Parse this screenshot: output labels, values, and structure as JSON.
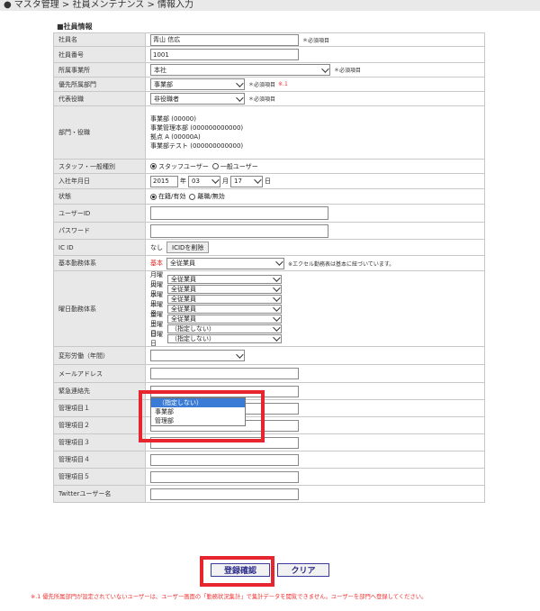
{
  "header": {
    "breadcrumb": "マスタ管理 > 社員メンテナンス > 情報入力",
    "hidden_title": "社員メンテナンス"
  },
  "section_title": "■社員情報",
  "fields": {
    "name": {
      "label": "社員名",
      "value": "青山 信広",
      "req": "＊必須項目"
    },
    "number": {
      "label": "社員番号",
      "value": "1001"
    },
    "office": {
      "label": "所属事業所",
      "value": "本社",
      "req": "＊必須項目"
    },
    "dept": {
      "label": "優先所属部門",
      "value": "事業部",
      "req": "＊必須項目",
      "note": "※.1"
    },
    "role": {
      "label": "代表役職",
      "value": "非役職者",
      "req": "＊必須項目"
    },
    "dept_role": {
      "label": "部門・役職",
      "items": [
        "事業部 (00000)",
        "事業管理本部 (000000000000)",
        "拠点 A (00000A)",
        "事業部テスト (000000000000)"
      ]
    },
    "staff_type": {
      "label": "スタッフ・一般種別",
      "opt1": "スタッフユーザー",
      "opt2": "一般ユーザー"
    },
    "join_date": {
      "label": "入社年月日",
      "year": "2015",
      "y": "年",
      "month": "03",
      "m": "月",
      "day": "17",
      "d": "日"
    },
    "status": {
      "label": "状態",
      "opt1": "在籍/有効",
      "opt2": "離職/無効"
    },
    "user_id": {
      "label": "ユーザーID",
      "value": ""
    },
    "password": {
      "label": "パスワード",
      "value": ""
    },
    "ic_id": {
      "label": "IC ID",
      "value": "なし",
      "btn": "ICIDを削除"
    },
    "base_work": {
      "label": "基本勤務体系",
      "tag": "基本",
      "value": "全従業員",
      "note": "※エクセル勤務表は基本に紐づいています。"
    },
    "weekday_work": {
      "label": "曜日勤務体系",
      "days": [
        {
          "day": "月曜日",
          "value": "全従業員"
        },
        {
          "day": "火曜日",
          "value": "全従業員"
        },
        {
          "day": "水曜日",
          "value": "全従業員"
        },
        {
          "day": "木曜日",
          "value": "全従業員"
        },
        {
          "day": "金曜日",
          "value": "全従業員"
        },
        {
          "day": "土曜日",
          "value": "（指定しない）"
        },
        {
          "day": "日曜日",
          "value": "（指定しない）"
        }
      ]
    },
    "flex_work": {
      "label": "変形労働（年間）"
    },
    "email": {
      "label": "メールアドレス"
    },
    "emergency": {
      "label": "緊急連絡先"
    },
    "m1": {
      "label": "管理項目１"
    },
    "m2": {
      "label": "管理項目２"
    },
    "m3": {
      "label": "管理項目３"
    },
    "m4": {
      "label": "管理項目４"
    },
    "m5": {
      "label": "管理項目５"
    },
    "twitter": {
      "label": "Twitterユーザー名"
    }
  },
  "dropdown": {
    "options": [
      "（指定しない）",
      "事業部",
      "管理部"
    ]
  },
  "actions": {
    "confirm": "登録確認",
    "clear": "クリア"
  },
  "footnote": "※.1 優先所属部門が設定されていないユーザーは、ユーザー画面の「勤務状況集計」で集計データを閲覧できません。ユーザーを部門へ登録してください。"
}
